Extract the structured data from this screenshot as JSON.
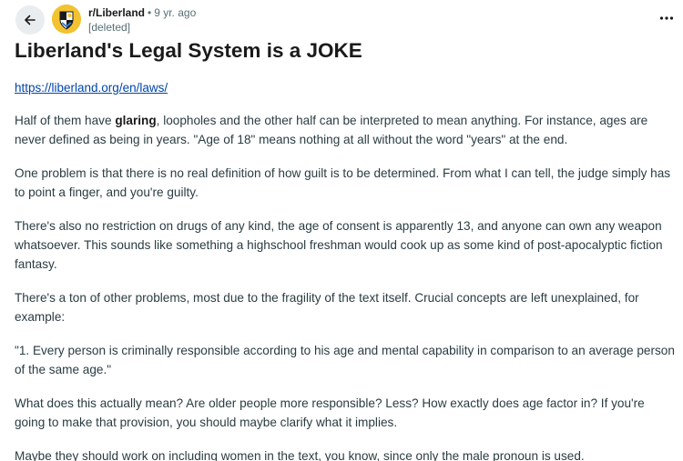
{
  "header": {
    "subreddit": "r/Liberland",
    "separator": "•",
    "age": "9 yr. ago",
    "author": "[deleted]"
  },
  "post": {
    "title": "Liberland's Legal System is a JOKE",
    "link": "https://liberland.org/en/laws/",
    "paragraphs": {
      "p1_before": "Half of them have ",
      "p1_bold": "glaring",
      "p1_after": ", loopholes and the other half can be interpreted to mean anything. For instance, ages are never defined as being in years. \"Age of 18\" means nothing at all without the word \"years\" at the end.",
      "p2": "One problem is that there is no real definition of how guilt is to be determined. From what I can tell, the judge simply has to point a finger, and you're guilty.",
      "p3": "There's also no restriction on drugs of any kind, the age of consent is apparently 13, and anyone can own any weapon whatsoever. This sounds like something a highschool freshman would cook up as some kind of post-apocalyptic fiction fantasy.",
      "p4": "There's a ton of other problems, most due to the fragility of the text itself. Crucial concepts are left unexplained, for example:",
      "p5": "\"1. Every person is criminally responsible according to his age and mental capability in comparison to an average person of the same age.\"",
      "p6": "What does this actually mean? Are older people more responsible? Less? How exactly does age factor in? If you're going to make that provision, you should maybe clarify what it implies.",
      "p7": "Maybe they should work on including women in the text, you know, since only the male pronoun is used."
    }
  },
  "icons": {
    "back": "arrow-left-icon",
    "more": "more-horizontal-icon",
    "avatar": "liberland-emblem-icon"
  },
  "colors": {
    "avatar_bg": "#f2c230",
    "link": "#0045ac",
    "muted": "#576f76"
  }
}
